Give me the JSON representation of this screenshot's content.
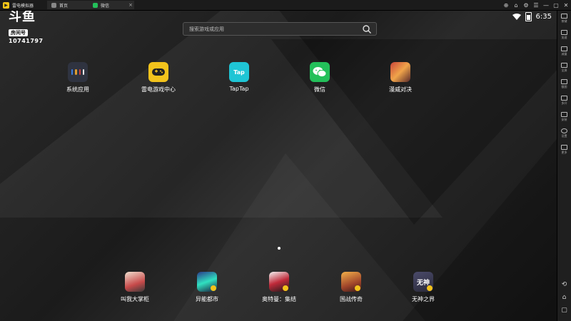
{
  "titlebar": {
    "app_title": "雷电模拟器",
    "tabs": [
      {
        "label": "首页"
      },
      {
        "label": "微信"
      }
    ],
    "tab_close": "×",
    "controls": [
      "⊕",
      "⌂",
      "⚙",
      "☰",
      "—",
      "▢",
      "✕"
    ]
  },
  "status": {
    "time": "6:35"
  },
  "watermark": {
    "logo": "斗鱼",
    "badge": "房间号",
    "room_id": "10741797"
  },
  "search": {
    "placeholder": "搜索游戏或应用"
  },
  "apps_top": [
    {
      "label": "系统应用"
    },
    {
      "label": "雷电游戏中心"
    },
    {
      "label": "TapTap",
      "icon_text": "Tap"
    },
    {
      "label": "微信"
    },
    {
      "label": "漫威对决"
    }
  ],
  "apps_bottom": [
    {
      "label": "叫我大掌柜"
    },
    {
      "label": "异能都市"
    },
    {
      "label": "奥特曼：集结"
    },
    {
      "label": "国战传奇"
    },
    {
      "label": "无神之界",
      "icon_text": "无神"
    }
  ],
  "toolbar": {
    "items": [
      "按键",
      "加速",
      "减量",
      "全屏",
      "截图",
      "多开",
      "安装",
      "设置",
      "更多"
    ],
    "bottom": [
      "⟲",
      "⌂",
      "▢"
    ]
  },
  "colors": {
    "accent": "#f3c31c",
    "taptap": "#1fc5d5",
    "wechat": "#23c05a"
  }
}
